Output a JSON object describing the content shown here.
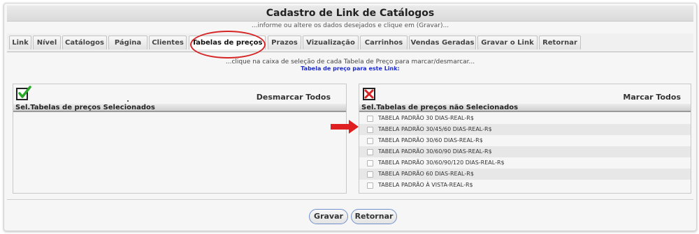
{
  "window": {
    "title": "Cadastro de Link de Catálogos",
    "subtitle": "...informe ou altere os dados desejados e clique em (Gravar)..."
  },
  "tabs": [
    {
      "label": "Link"
    },
    {
      "label": "Nível"
    },
    {
      "label": "Catálogos"
    },
    {
      "label": "Página"
    },
    {
      "label": "Clientes"
    },
    {
      "label": "Tabelas de preços",
      "active": true
    },
    {
      "label": "Prazos"
    },
    {
      "label": "Vizualização"
    },
    {
      "label": "Carrinhos"
    },
    {
      "label": "Vendas Geradas"
    },
    {
      "label": "Gravar o Link"
    },
    {
      "label": "Retornar"
    }
  ],
  "instructions": {
    "line1": "...clique na caixa de seleção de cada Tabela de Preço para marcar/desmarcar...",
    "line2": "Tabela de preço para este Link:"
  },
  "selected_panel": {
    "icon": "checkmark-icon",
    "action_label": "Desmarcar Todos",
    "column_header": "Sel.Tabelas de preços Selecionados",
    "items": []
  },
  "unselected_panel": {
    "icon": "x-mark-icon",
    "action_label": "Marcar Todos",
    "column_header": "Sel.Tabelas de preços não Selecionados",
    "items": [
      {
        "label": "TABELA PADRÃO 30 DIAS-REAL-R$",
        "checked": false
      },
      {
        "label": "TABELA PADRÃO 30/45/60 DIAS-REAL-R$",
        "checked": false
      },
      {
        "label": "TABELA PADRÃO 30/60 DIAS-REAL-R$",
        "checked": false
      },
      {
        "label": "TABELA PADRÃO 30/60/90 DIAS-REAL-R$",
        "checked": false
      },
      {
        "label": "TABELA PADRÃO 30/60/90/120 DIAS-REAL-R$",
        "checked": false
      },
      {
        "label": "TABELA PADRÃO 60 DIAS-REAL-R$",
        "checked": false
      },
      {
        "label": "TABELA PADRÃO À VISTA-REAL-R$",
        "checked": false
      }
    ]
  },
  "buttons": {
    "save": "Gravar",
    "back": "Retornar"
  },
  "colors": {
    "highlight_red": "#d62424",
    "link_blue": "#1b2bd0",
    "button_border": "#6f8fcb"
  }
}
